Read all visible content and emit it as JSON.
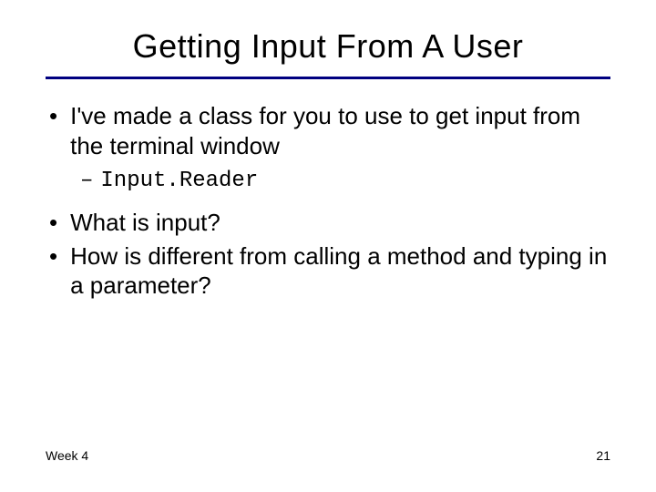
{
  "title": "Getting Input From A User",
  "bullets": {
    "b0": "I've made a class for you to use to get input from the terminal window",
    "b0_sub": "Input.Reader",
    "b1": "What is input?",
    "b2": "How is different from calling a method and typing in a parameter?"
  },
  "footer": {
    "left": "Week 4",
    "right": "21"
  }
}
